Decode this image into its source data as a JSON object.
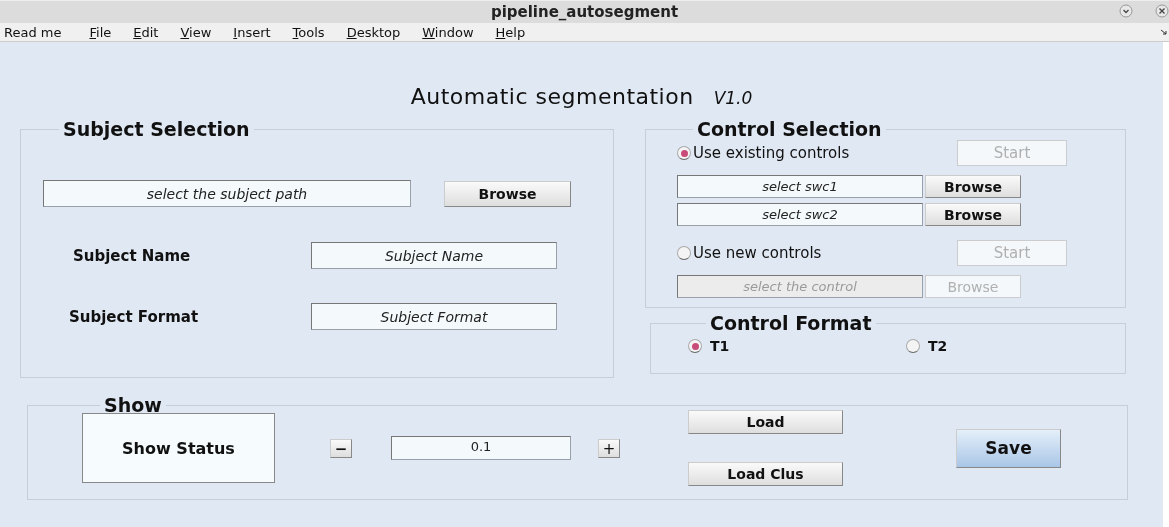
{
  "window": {
    "title": "pipeline_autosegment"
  },
  "menu": [
    {
      "label": "Read me",
      "mnemonic": false
    },
    {
      "label": "File",
      "mnemonic": true
    },
    {
      "label": "Edit",
      "mnemonic": true
    },
    {
      "label": "View",
      "mnemonic": true
    },
    {
      "label": "Insert",
      "mnemonic": true
    },
    {
      "label": "Tools",
      "mnemonic": true
    },
    {
      "label": "Desktop",
      "mnemonic": true
    },
    {
      "label": "Window",
      "mnemonic": true
    },
    {
      "label": "Help",
      "mnemonic": true
    }
  ],
  "heading": {
    "title": "Automatic segmentation",
    "version": "V1.0"
  },
  "subject_selection": {
    "title": "Subject Selection",
    "path_field": {
      "value": "select the subject path"
    },
    "browse_button": "Browse",
    "fields": [
      {
        "label": "Subject Name",
        "value": "Subject Name"
      },
      {
        "label": "Subject Format",
        "value": "Subject Format"
      }
    ]
  },
  "control_selection": {
    "title": "Control Selection",
    "options": [
      {
        "label": "Use existing controls",
        "selected": true,
        "start_button": {
          "label": "Start",
          "disabled": true
        },
        "files": [
          {
            "value": "select swc1",
            "disabled": false,
            "browse": {
              "label": "Browse",
              "disabled": false
            }
          },
          {
            "value": "select swc2",
            "disabled": false,
            "browse": {
              "label": "Browse",
              "disabled": false
            }
          }
        ]
      },
      {
        "label": "Use new controls",
        "selected": false,
        "start_button": {
          "label": "Start",
          "disabled": true
        },
        "files": [
          {
            "value": "select the control",
            "disabled": true,
            "browse": {
              "label": "Browse",
              "disabled": true
            }
          }
        ]
      }
    ]
  },
  "control_format": {
    "title": "Control Format",
    "options": [
      {
        "label": "T1",
        "selected": true
      },
      {
        "label": "T2",
        "selected": false
      }
    ]
  },
  "show": {
    "title": "Show",
    "status": "Show Status",
    "decrement": "−",
    "value": "0.1",
    "increment": "+",
    "load_buttons": [
      "Load",
      "Load Clus"
    ],
    "save_button": "Save"
  }
}
